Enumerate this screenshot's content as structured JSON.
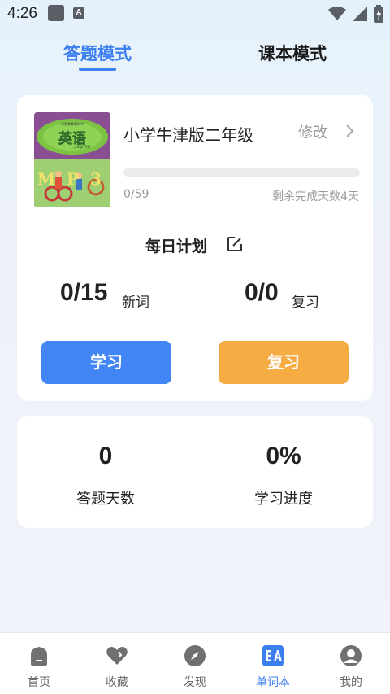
{
  "status_bar": {
    "time": "4:26",
    "a_glyph": "A"
  },
  "tabs": [
    {
      "label": "答题模式",
      "active": true
    },
    {
      "label": "课本模式",
      "active": false
    }
  ],
  "book": {
    "cover_title": "英语",
    "cover_series": "义务教育教科书",
    "cover_grade": "二年级 下册",
    "cover_letters": "M  P  3",
    "title": "小学牛津版二年级",
    "edit_label": "修改",
    "progress_fraction": 0,
    "progress_text": "0/59",
    "remaining_text": "剩余完成天数4天"
  },
  "plan": {
    "title": "每日计划",
    "new_words_value": "0/15",
    "new_words_label": "新词",
    "review_value": "0/0",
    "review_label": "复习",
    "study_button": "学习",
    "review_button": "复习"
  },
  "stats": {
    "days_value": "0",
    "days_label": "答题天数",
    "progress_value": "0%",
    "progress_label": "学习进度"
  },
  "bottom_nav": [
    {
      "label": "首页",
      "icon": "home-icon",
      "active": false
    },
    {
      "label": "收藏",
      "icon": "heart-icon",
      "active": false
    },
    {
      "label": "发现",
      "icon": "compass-icon",
      "active": false
    },
    {
      "label": "单词本",
      "icon": "wordbook-icon",
      "active": true
    },
    {
      "label": "我的",
      "icon": "profile-icon",
      "active": false
    }
  ],
  "colors": {
    "accent": "#3b7ff0",
    "study_button": "#4286f5",
    "review_button": "#f4ac43",
    "muted_text": "#999999",
    "nav_inactive_icon": "#707070"
  }
}
